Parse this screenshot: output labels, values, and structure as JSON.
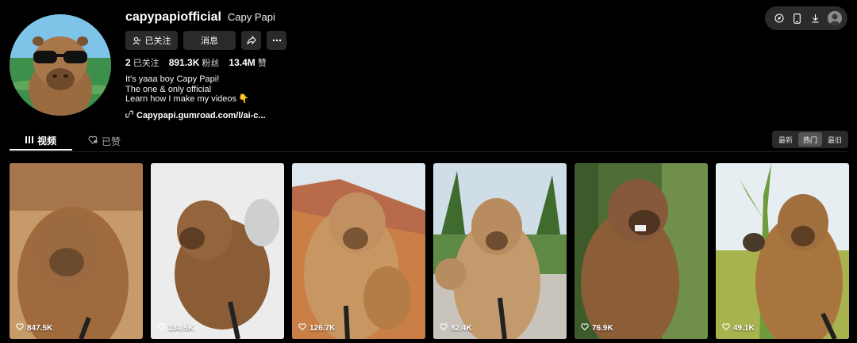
{
  "profile": {
    "handle": "capypapiofficial",
    "nickname": "Capy Papi",
    "follow_label": "已关注",
    "message_label": "消息",
    "stats": [
      {
        "value": "2",
        "label": "已关注"
      },
      {
        "value": "891.3K",
        "label": "粉丝"
      },
      {
        "value": "13.4M",
        "label": "赞"
      }
    ],
    "bio": [
      "It's yaaa boy Capy Papi!",
      "The one & only official",
      "Learn how I make my videos"
    ],
    "bio_emoji": "👇",
    "link": "Capypapi.gumroad.com/l/ai-c..."
  },
  "tabs": [
    {
      "label": "视频",
      "icon": "grid-bars-icon",
      "active": true
    },
    {
      "label": "已赞",
      "icon": "heart-lock-icon",
      "active": false
    }
  ],
  "sort": [
    {
      "label": "最新",
      "active": false
    },
    {
      "label": "热门",
      "active": true
    },
    {
      "label": "最旧",
      "active": false
    }
  ],
  "videos": [
    {
      "likes": "847.5K",
      "bg": "#b98a5c"
    },
    {
      "likes": "134.5K",
      "bg": "#e8e8e8"
    },
    {
      "likes": "126.7K",
      "bg": "#c9a57a"
    },
    {
      "likes": "82.4K",
      "bg": "#8fa070"
    },
    {
      "likes": "76.9K",
      "bg": "#55703c"
    },
    {
      "likes": "49.1K",
      "bg": "#9aa860"
    }
  ],
  "colors": {
    "accent": "#ffffff",
    "button_bg": "#2a2a2a",
    "page_bg": "#000000"
  }
}
